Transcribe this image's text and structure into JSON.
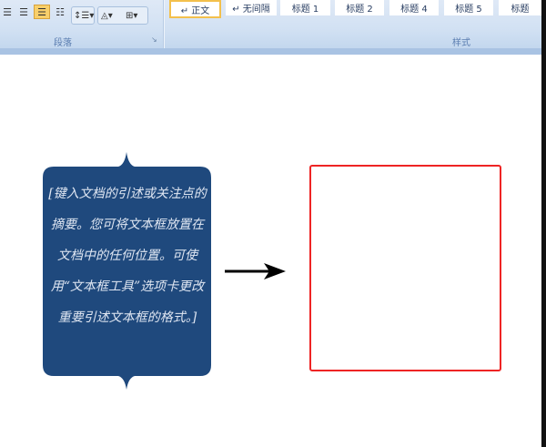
{
  "ribbon": {
    "paragraph_group_label": "段落",
    "styles_group_label": "样式",
    "paragraph_buttons": [
      "center-align-icon",
      "right-align-icon",
      "justify-icon",
      "distributed-icon",
      "line-spacing-icon",
      "shading-icon",
      "borders-icon"
    ],
    "styles": [
      {
        "label": "↵ 正文",
        "selected": true
      },
      {
        "label": "↵ 无间隔",
        "selected": false
      },
      {
        "label": "标题 1",
        "selected": false
      },
      {
        "label": "标题 2",
        "selected": false
      },
      {
        "label": "标题 4",
        "selected": false
      },
      {
        "label": "标题 5",
        "selected": false
      },
      {
        "label": "标题",
        "selected": false
      }
    ]
  },
  "document": {
    "callout_text": "[键入文档的引述或关注点的摘要。您可将文本框放置在文档中的任何位置。可使用“文本框工具”选项卡更改重要引述文本框的格式。]",
    "callout_color": "#1f497d",
    "box_border_color": "#ee2424"
  }
}
